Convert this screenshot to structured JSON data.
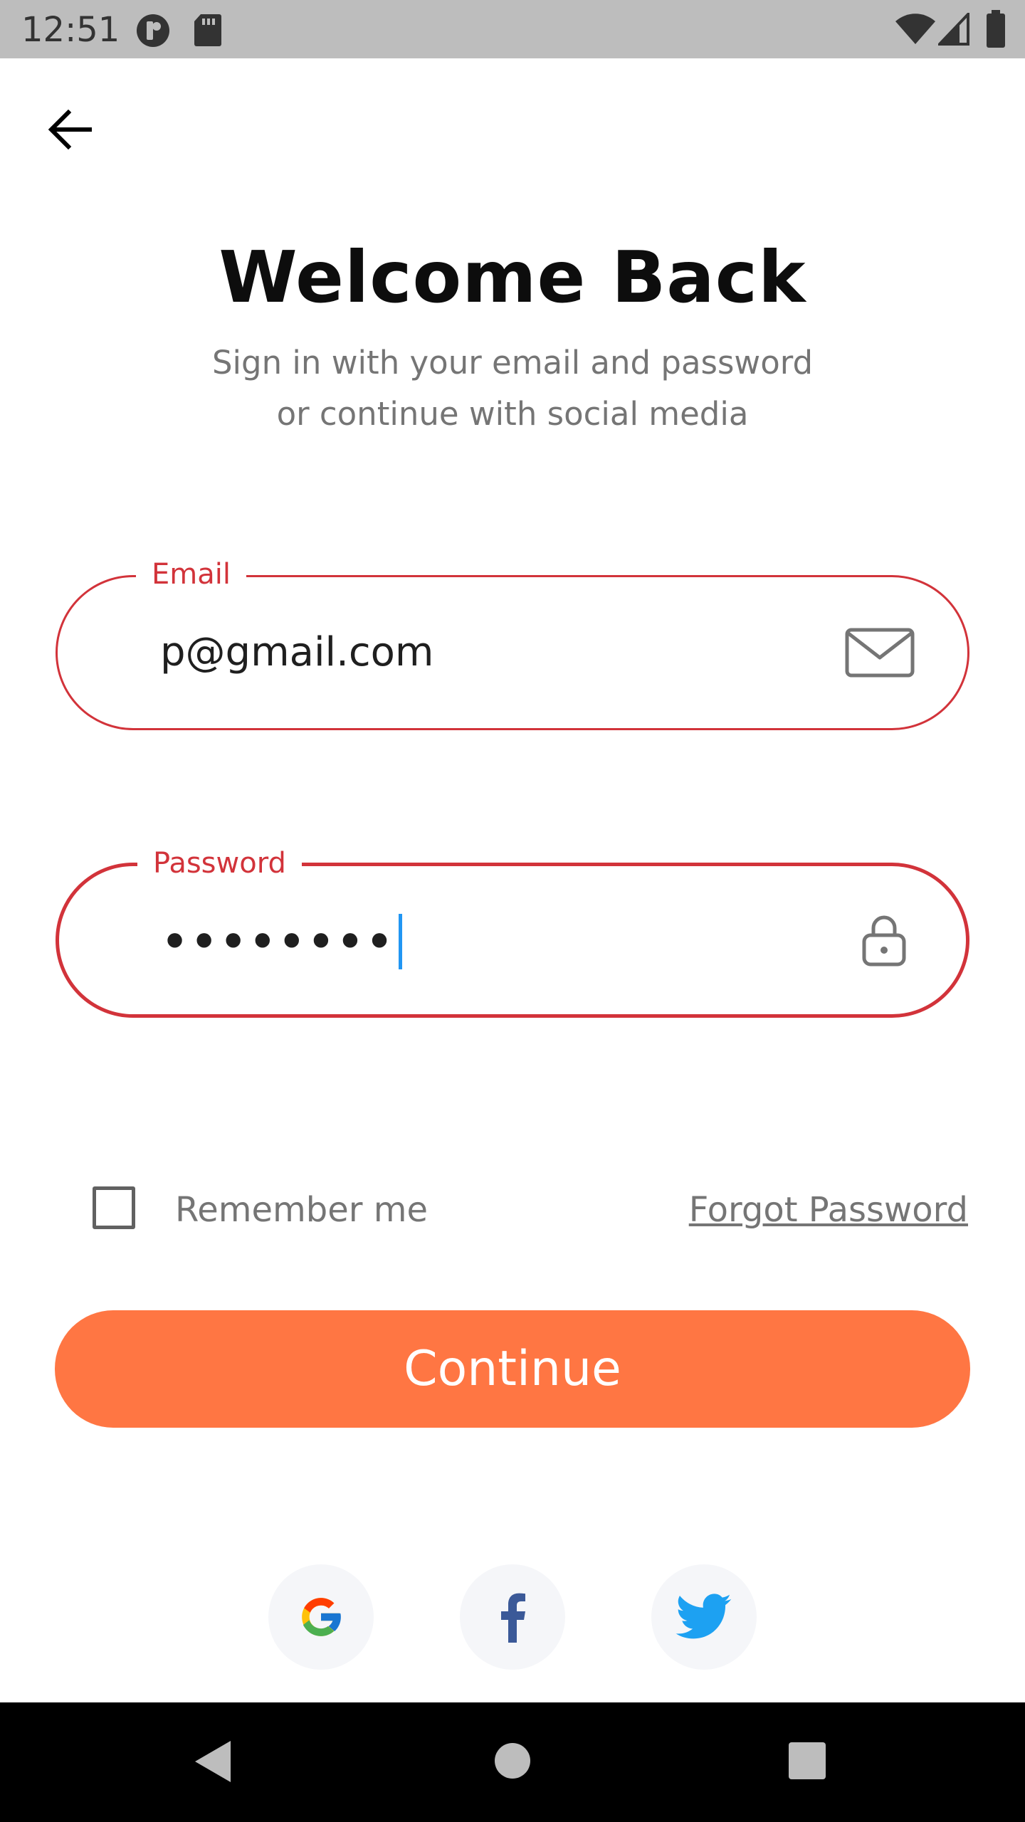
{
  "status_bar": {
    "time": "12:51",
    "icons": [
      "app-notification-icon",
      "sd-card-icon",
      "wifi-icon",
      "signal-icon",
      "battery-icon"
    ]
  },
  "header": {
    "back_icon": "arrow-left-icon"
  },
  "title": "Welcome Back",
  "subtitle_line1": "Sign in with your email and password",
  "subtitle_line2": "or continue with social media",
  "email_field": {
    "label": "Email",
    "value": "p@gmail.com",
    "icon": "mail-icon"
  },
  "password_field": {
    "label": "Password",
    "value": "••••••••",
    "icon": "lock-icon"
  },
  "remember_me": {
    "label": "Remember me",
    "checked": false
  },
  "forgot_password": "Forgot Password",
  "continue_button": "Continue",
  "social": [
    "google-icon",
    "facebook-icon",
    "twitter-icon"
  ],
  "colors": {
    "accent": "#FF7643",
    "error_border": "#D2333A",
    "text_dark": "#0D0D0D",
    "text_muted": "#757575",
    "social_bg": "#F5F6F9",
    "caret": "#2196F3"
  },
  "nav_bar": [
    "back-triangle-icon",
    "home-circle-icon",
    "recents-square-icon"
  ]
}
